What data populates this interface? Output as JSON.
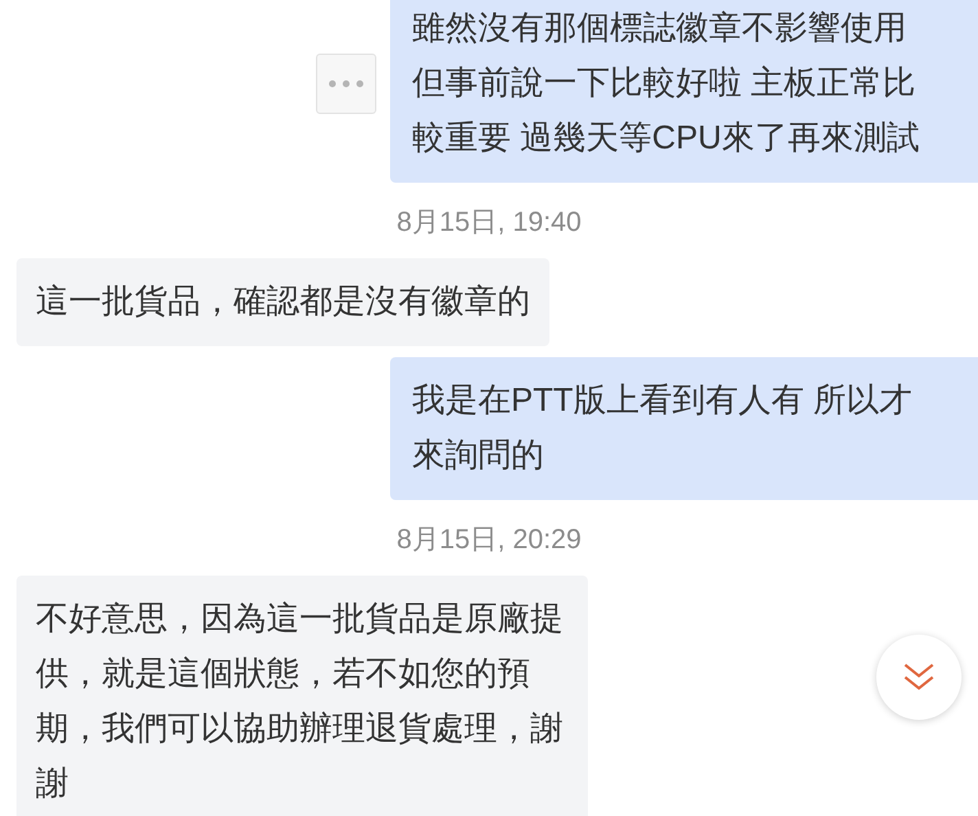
{
  "messages": [
    {
      "kind": "sent",
      "menu_button": true,
      "text": "雖然沒有那個標誌徽章不影響使用但事前說一下比較好啦 主板正常比較重要 過幾天等CPU來了再來測試"
    },
    {
      "kind": "timestamp",
      "text": "8月15日, 19:40"
    },
    {
      "kind": "received",
      "menu_button": false,
      "text": "這一批貨品，確認都是沒有徽章的"
    },
    {
      "kind": "sent",
      "menu_button": false,
      "text": "我是在PTT版上看到有人有 所以才來詢問的"
    },
    {
      "kind": "timestamp",
      "text": "8月15日, 20:29"
    },
    {
      "kind": "received",
      "menu_button": false,
      "text": "不好意思，因為這一批貨品是原廠提供，就是這個狀態，若不如您的預期，我們可以協助辦理退貨處理，謝謝"
    }
  ]
}
